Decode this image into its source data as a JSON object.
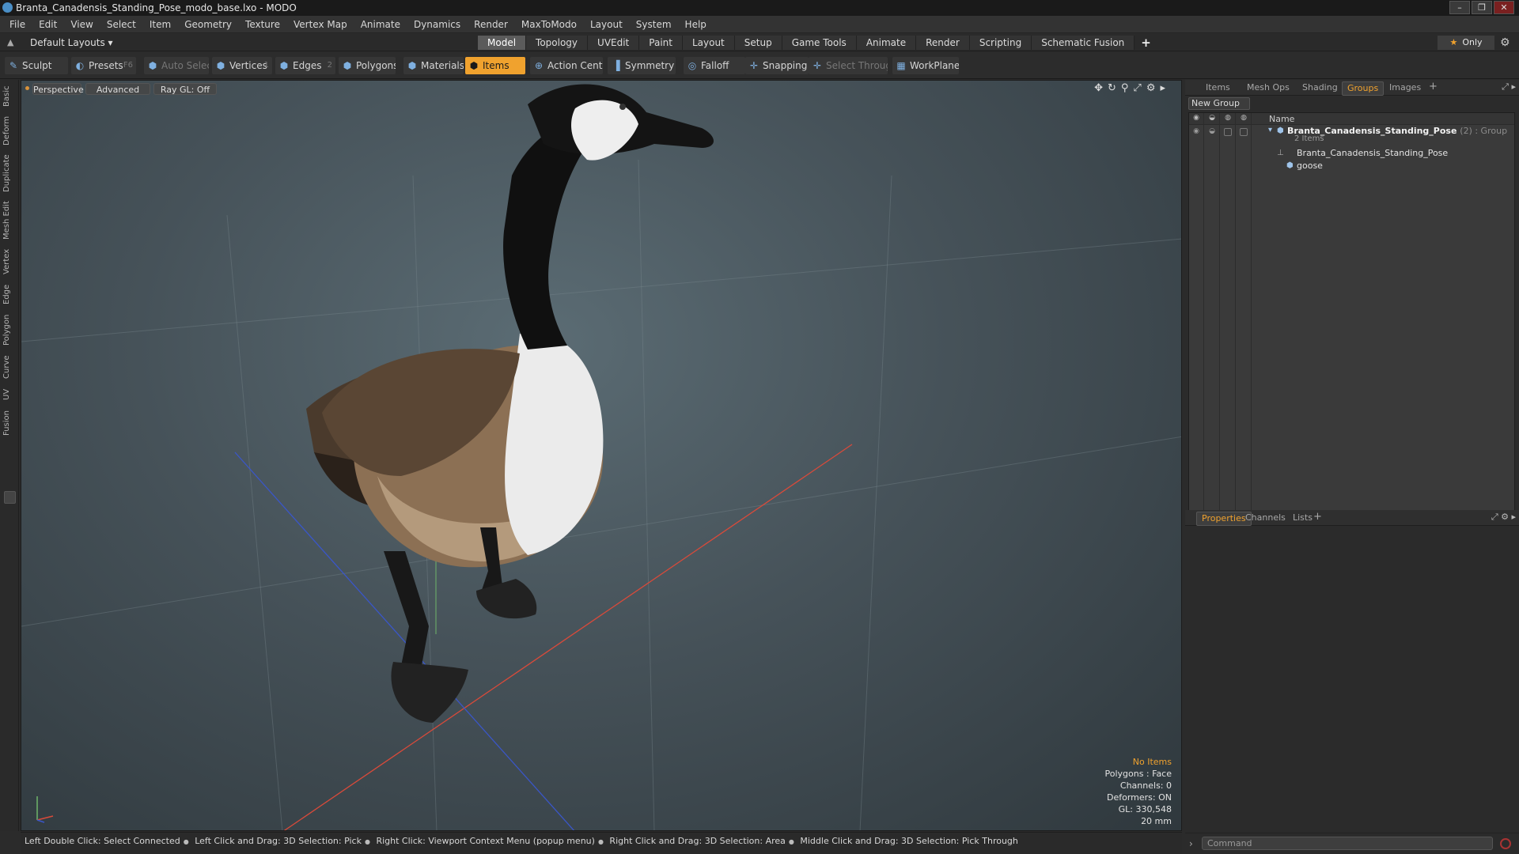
{
  "window": {
    "title": "Branta_Canadensis_Standing_Pose_modo_base.lxo - MODO"
  },
  "menubar": {
    "items": [
      "File",
      "Edit",
      "View",
      "Select",
      "Item",
      "Geometry",
      "Texture",
      "Vertex Map",
      "Animate",
      "Dynamics",
      "Render",
      "MaxToModo",
      "Layout",
      "System",
      "Help"
    ]
  },
  "layoutbar": {
    "layouts_label": "Default Layouts",
    "tabs": [
      "Model",
      "Topology",
      "UVEdit",
      "Paint",
      "Layout",
      "Setup",
      "Game Tools",
      "Animate",
      "Render",
      "Scripting",
      "Schematic Fusion"
    ],
    "active_tab": "Model",
    "add_label": "+",
    "only_label": "Only"
  },
  "toolbar": {
    "sculpt": "Sculpt",
    "presets": "Presets",
    "presets_hotkey": "F6",
    "auto_select": "Auto Select",
    "vertices": "Vertices",
    "vertices_hotkey": "1",
    "edges": "Edges",
    "edges_hotkey": "2",
    "polygons": "Polygons",
    "materials": "Materials",
    "items": "Items",
    "action_center": "Action Center",
    "symmetry": "Symmetry",
    "falloff": "Falloff",
    "snapping": "Snapping",
    "select_through": "Select Through",
    "workplane": "WorkPlane"
  },
  "left_tabs": [
    "Basic",
    "Deform",
    "Duplicate",
    "Mesh Edit",
    "Vertex",
    "Edge",
    "Polygon",
    "Curve",
    "UV",
    "Fusion"
  ],
  "viewport": {
    "view_label": "Perspective",
    "shading_label": "Advanced",
    "raygl_label": "Ray GL: Off",
    "info": {
      "no_items": "No Items",
      "polygons": "Polygons : Face",
      "channels": "Channels: 0",
      "deformers": "Deformers: ON",
      "gl": "GL: 330,548",
      "scale": "20 mm"
    }
  },
  "statusbar": {
    "hints": [
      "Left Double Click: Select Connected",
      "Left Click and Drag: 3D Selection: Pick",
      "Right Click: Viewport Context Menu (popup menu)",
      "Right Click and Drag: 3D Selection: Area",
      "Middle Click and Drag: 3D Selection: Pick Through"
    ]
  },
  "groups_panel": {
    "tabs": [
      "Items",
      "Mesh Ops",
      "Shading",
      "Groups",
      "Images"
    ],
    "active_tab": "Groups",
    "add_label": "+",
    "new_group_label": "New Group",
    "name_header": "Name",
    "group": {
      "name": "Branta_Canadensis_Standing_Pose",
      "suffix": "(2) : Group",
      "count": "2 Items",
      "children": [
        "Branta_Canadensis_Standing_Pose",
        "goose"
      ]
    }
  },
  "properties_panel": {
    "tabs": [
      "Properties",
      "Channels",
      "Lists"
    ],
    "active_tab": "Properties",
    "add_label": "+"
  },
  "command": {
    "placeholder": "Command"
  },
  "colors": {
    "accent": "#f0a22e",
    "background": "#2b2b2b",
    "viewport": "#465259"
  }
}
